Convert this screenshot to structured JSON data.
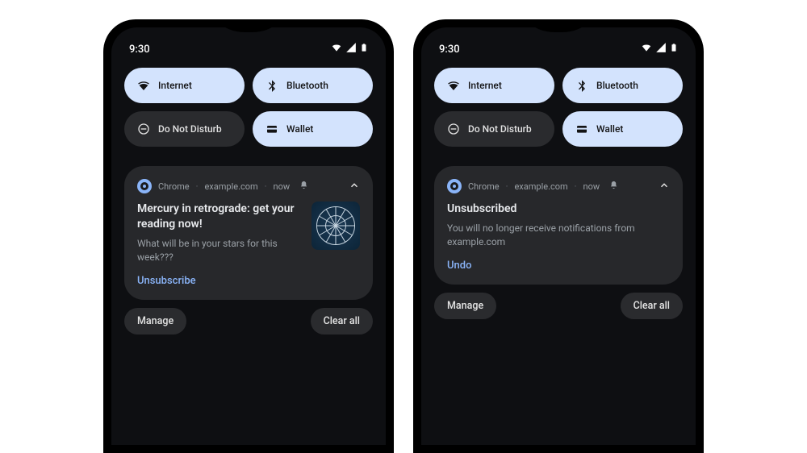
{
  "status": {
    "time": "9:30"
  },
  "quick_settings": {
    "internet": "Internet",
    "bluetooth": "Bluetooth",
    "dnd": "Do Not Disturb",
    "wallet": "Wallet"
  },
  "notification_left": {
    "app": "Chrome",
    "source": "example.com",
    "when": "now",
    "title": "Mercury in retrograde: get your reading now!",
    "body": "What will be in your stars for this week???",
    "action": "Unsubscribe"
  },
  "notification_right": {
    "app": "Chrome",
    "source": "example.com",
    "when": "now",
    "title": "Unsubscribed",
    "body": "You will no longer receive notifications from example.com",
    "action": "Undo"
  },
  "footer": {
    "manage": "Manage",
    "clear_all": "Clear all"
  }
}
